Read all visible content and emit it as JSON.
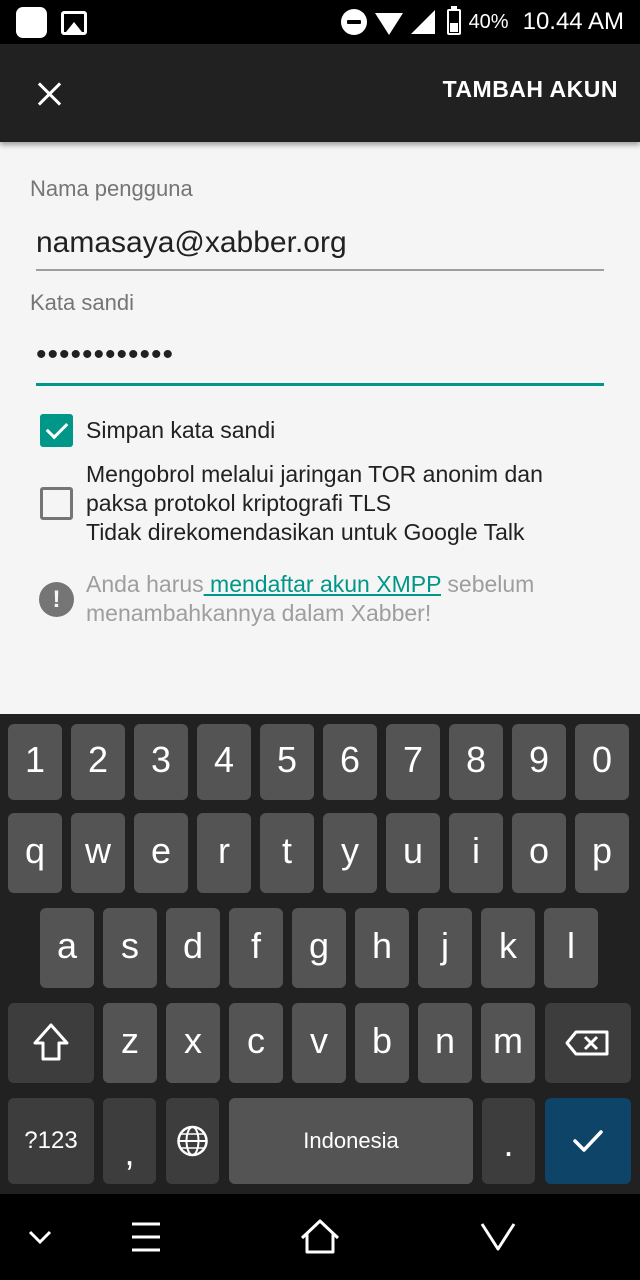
{
  "status_bar": {
    "battery": "40%",
    "time": "10.44 AM"
  },
  "action_bar": {
    "close_icon": "close-icon",
    "action": "TAMBAH AKUN"
  },
  "form": {
    "username_label": "Nama pengguna",
    "username_value": "namasaya@xabber.org",
    "password_label": "Kata sandi",
    "password_value": "••••••••••••",
    "save_password_label": "Simpan kata sandi",
    "save_password_checked": true,
    "tor_line1": "Mengobrol melalui jaringan TOR anonim dan",
    "tor_line2": "paksa protokol kriptografi TLS",
    "tor_line3": "Tidak direkomendasikan untuk Google Talk",
    "tor_checked": false,
    "info_prefix": "Anda harus",
    "info_link": " mendaftar akun XMPP",
    "info_suffix": " sebelum menambahkannya dalam Xabber!",
    "accent_color": "#009688"
  },
  "keyboard": {
    "row_numbers": [
      "1",
      "2",
      "3",
      "4",
      "5",
      "6",
      "7",
      "8",
      "9",
      "0"
    ],
    "row_q": [
      "q",
      "w",
      "e",
      "r",
      "t",
      "y",
      "u",
      "i",
      "o",
      "p"
    ],
    "row_a": [
      "a",
      "s",
      "d",
      "f",
      "g",
      "h",
      "j",
      "k",
      "l"
    ],
    "row_z": [
      "z",
      "x",
      "c",
      "v",
      "b",
      "n",
      "m"
    ],
    "symbols_label": "?123",
    "comma": ",",
    "space_label": "Indonesia",
    "period": ".",
    "icons": [
      "shift-icon",
      "backspace-icon",
      "globe-icon",
      "checkmark-icon"
    ]
  },
  "nav_bar": {
    "icons": [
      "chevron-down-icon",
      "menu-icon",
      "home-icon",
      "back-icon"
    ]
  }
}
